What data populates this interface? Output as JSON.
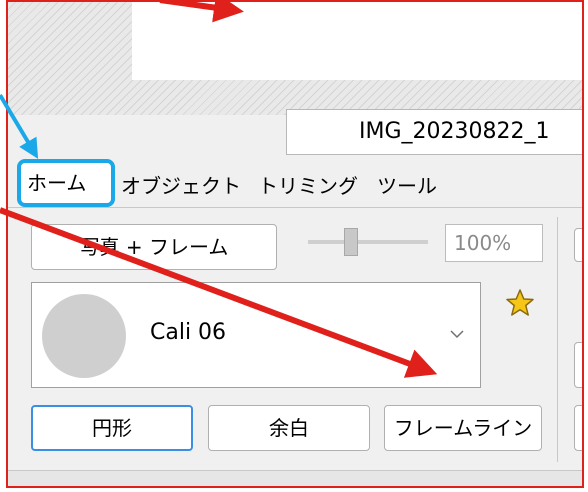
{
  "file_tab": {
    "label": "IMG_20230822_1"
  },
  "tabs": [
    {
      "label": "ホーム",
      "active": true
    },
    {
      "label": "オブジェクト"
    },
    {
      "label": "トリミング"
    },
    {
      "label": "ツール"
    }
  ],
  "toolbar": {
    "photo_frame_label": "写真 + フレーム",
    "zoom_value": "100%"
  },
  "frame_select": {
    "selected": "Cali 06"
  },
  "shape_buttons": {
    "circle": "円形",
    "margin": "余白",
    "frame_line": "フレームライン"
  },
  "icons": {
    "favorite": "star-icon",
    "dropdown": "chevron-down-icon"
  },
  "colors": {
    "annotation_arrow": "#e0201a",
    "highlight_box": "#1aa8e8",
    "active_button_border": "#3b8ee6",
    "star_fill": "#f5c518"
  }
}
